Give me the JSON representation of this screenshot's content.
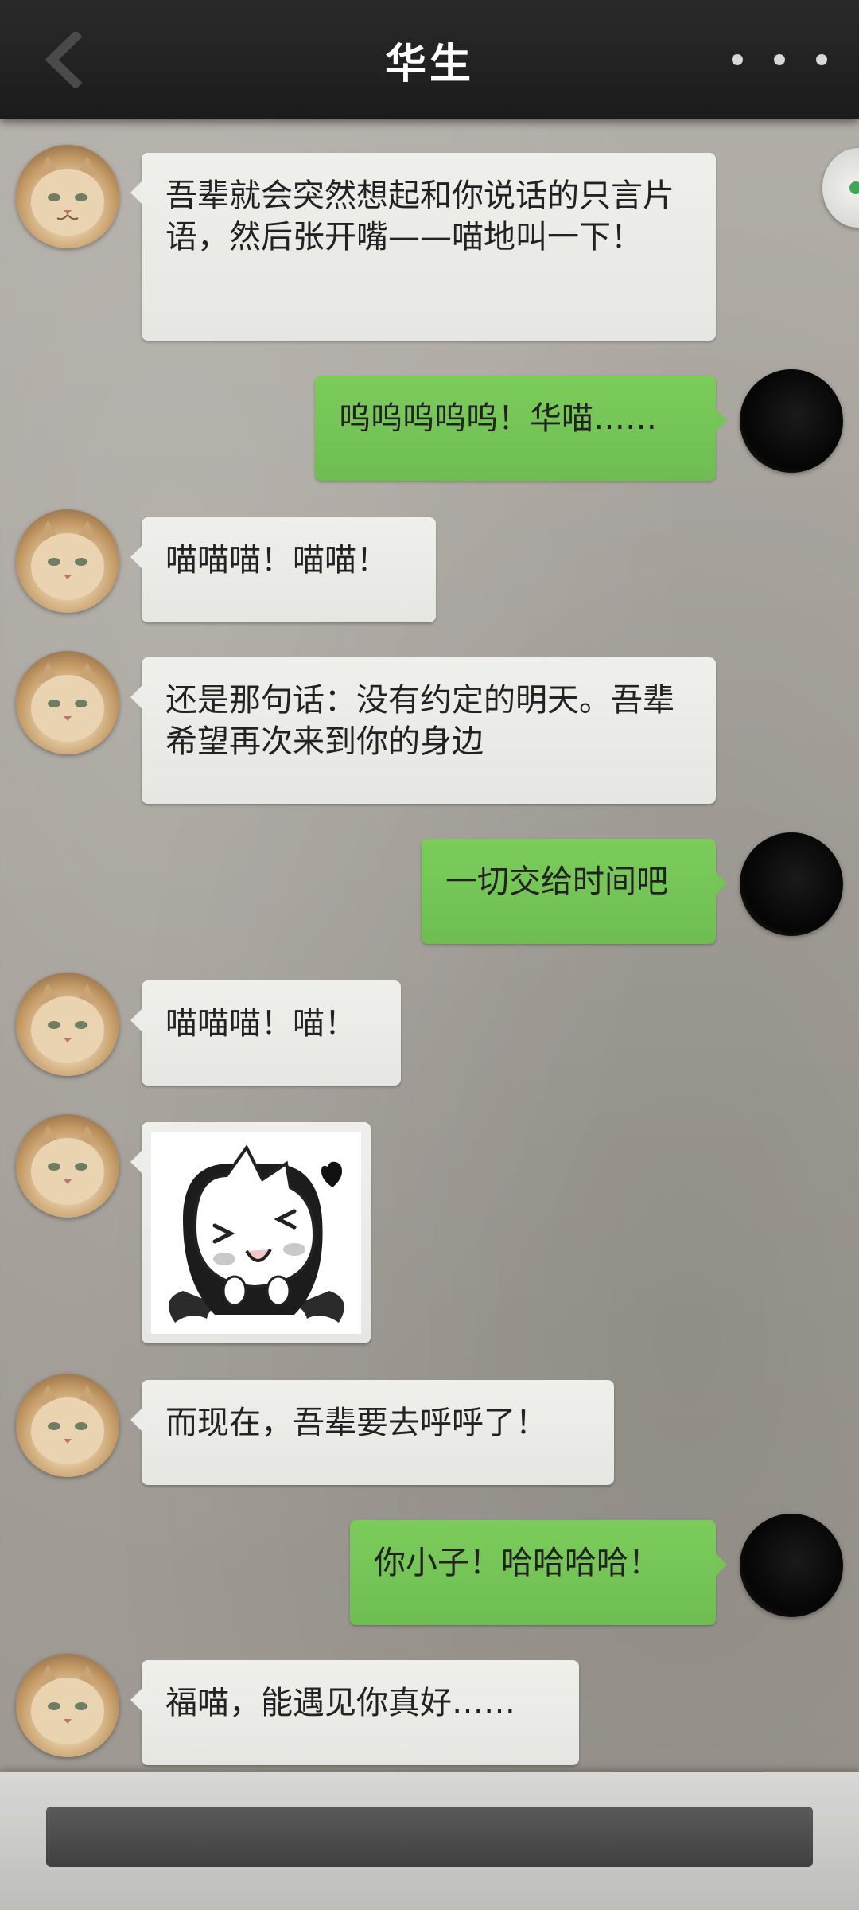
{
  "header": {
    "title": "华生",
    "back_icon": "chevron-left-icon",
    "more_icon": "more-dots-icon"
  },
  "messages": [
    {
      "from": "contact",
      "text": "吾辈就会突然想起和你说话的只言片语，然后张开嘴——喵地叫一下！"
    },
    {
      "from": "me",
      "text": "呜呜呜呜呜！华喵……"
    },
    {
      "from": "contact",
      "text": "喵喵喵！喵喵！"
    },
    {
      "from": "contact",
      "text": "还是那句话：没有约定的明天。吾辈希望再次来到你的身边"
    },
    {
      "from": "me",
      "text": "一切交给时间吧"
    },
    {
      "from": "contact",
      "text": "喵喵喵！喵！"
    },
    {
      "from": "contact",
      "type": "sticker",
      "sticker": "vampire-cat-sticker"
    },
    {
      "from": "contact",
      "text": "而现在，吾辈要去呼呼了！"
    },
    {
      "from": "me",
      "text": "你小子！哈哈哈哈！"
    },
    {
      "from": "contact",
      "text": "福喵，能遇见你真好……"
    }
  ],
  "input": {
    "value": "",
    "placeholder": ""
  },
  "colors": {
    "header_bg": "#1f1f1f",
    "incoming_bubble": "#ecece9",
    "outgoing_bubble": "#74c457",
    "background": "#a8a49d"
  }
}
